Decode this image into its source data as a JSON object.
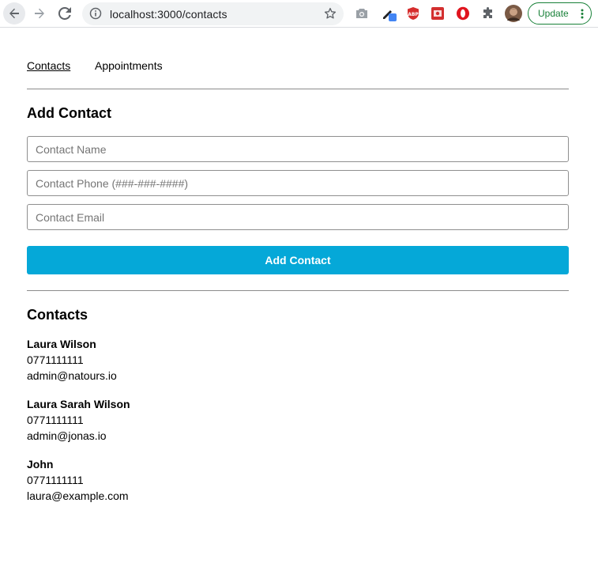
{
  "browser": {
    "url": "localhost:3000/contacts",
    "update_label": "Update",
    "accent_update": "#188038"
  },
  "nav": {
    "contacts": "Contacts",
    "appointments": "Appointments"
  },
  "form": {
    "title": "Add Contact",
    "name_placeholder": "Contact Name",
    "phone_placeholder": "Contact Phone (###-###-####)",
    "email_placeholder": "Contact Email",
    "submit_label": "Add Contact",
    "button_color": "#05a8d8"
  },
  "list": {
    "title": "Contacts",
    "contacts": [
      {
        "name": "Laura Wilson",
        "phone": "0771111111",
        "email": "admin@natours.io"
      },
      {
        "name": "Laura Sarah Wilson",
        "phone": "0771111111",
        "email": "admin@jonas.io"
      },
      {
        "name": "John",
        "phone": "0771111111",
        "email": "laura@example.com"
      }
    ]
  }
}
